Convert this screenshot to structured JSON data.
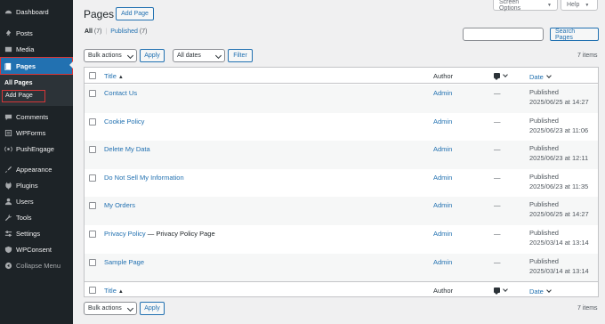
{
  "sidebar": {
    "items": [
      {
        "label": "Dashboard",
        "icon": "dashboard-icon"
      },
      {
        "label": "Posts",
        "icon": "pin-icon"
      },
      {
        "label": "Media",
        "icon": "media-icon"
      },
      {
        "label": "Pages",
        "icon": "pages-icon"
      },
      {
        "label": "Comments",
        "icon": "comment-icon"
      },
      {
        "label": "WPForms",
        "icon": "forms-icon"
      },
      {
        "label": "PushEngage",
        "icon": "broadcast-icon"
      },
      {
        "label": "Appearance",
        "icon": "brush-icon"
      },
      {
        "label": "Plugins",
        "icon": "plug-icon"
      },
      {
        "label": "Users",
        "icon": "user-icon"
      },
      {
        "label": "Tools",
        "icon": "wrench-icon"
      },
      {
        "label": "Settings",
        "icon": "settings-icon"
      },
      {
        "label": "WPConsent",
        "icon": "shield-icon"
      },
      {
        "label": "Collapse Menu",
        "icon": "collapse-icon"
      }
    ],
    "submenu": {
      "all_pages": "All Pages",
      "add_page": "Add Page"
    }
  },
  "header": {
    "title": "Pages",
    "add_button": "Add Page",
    "screen_options": "Screen Options",
    "help": "Help"
  },
  "filters": {
    "all_label": "All",
    "all_count": "(7)",
    "separator": "|",
    "published_label": "Published",
    "published_count": "(7)",
    "search_button": "Search Pages",
    "bulk_actions": "Bulk actions",
    "apply": "Apply",
    "all_dates": "All dates",
    "filter": "Filter",
    "items_count": "7 items"
  },
  "table": {
    "headers": {
      "title": "Title",
      "author": "Author",
      "date": "Date"
    },
    "rows": [
      {
        "title": "Contact Us",
        "suffix": "",
        "author": "Admin",
        "comments": "—",
        "status": "Published",
        "date": "2025/06/25 at 14:27"
      },
      {
        "title": "Cookie Policy",
        "suffix": "",
        "author": "Admin",
        "comments": "—",
        "status": "Published",
        "date": "2025/06/23 at 11:06"
      },
      {
        "title": "Delete My Data",
        "suffix": "",
        "author": "Admin",
        "comments": "—",
        "status": "Published",
        "date": "2025/06/23 at 12:11"
      },
      {
        "title": "Do Not Sell My Information",
        "suffix": "",
        "author": "Admin",
        "comments": "—",
        "status": "Published",
        "date": "2025/06/23 at 11:35"
      },
      {
        "title": "My Orders",
        "suffix": "",
        "author": "Admin",
        "comments": "—",
        "status": "Published",
        "date": "2025/06/25 at 14:27"
      },
      {
        "title": "Privacy Policy",
        "suffix": " — Privacy Policy Page",
        "author": "Admin",
        "comments": "—",
        "status": "Published",
        "date": "2025/03/14 at 13:14"
      },
      {
        "title": "Sample Page",
        "suffix": "",
        "author": "Admin",
        "comments": "—",
        "status": "Published",
        "date": "2025/03/14 at 13:14"
      }
    ]
  },
  "colors": {
    "accent": "#2271b1",
    "sidebar_bg": "#1d2327",
    "highlight_outline": "#d63638"
  }
}
